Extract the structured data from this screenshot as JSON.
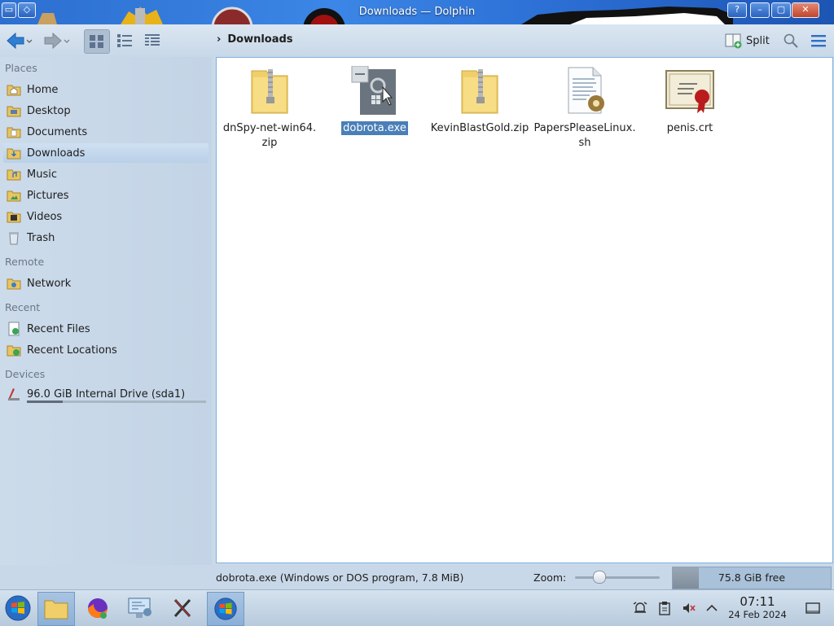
{
  "window": {
    "title": "Downloads — Dolphin"
  },
  "toolbar": {
    "breadcrumb": "Downloads",
    "split_label": "Split"
  },
  "sidebar": {
    "sections": {
      "places": "Places",
      "remote": "Remote",
      "recent": "Recent",
      "devices": "Devices"
    },
    "places": [
      "Home",
      "Desktop",
      "Documents",
      "Downloads",
      "Music",
      "Pictures",
      "Videos",
      "Trash"
    ],
    "remote": [
      "Network"
    ],
    "recent": [
      "Recent Files",
      "Recent Locations"
    ],
    "devices": [
      {
        "label": "96.0 GiB Internal Drive (sda1)",
        "usage_fraction": 0.2
      }
    ],
    "selected": "Downloads"
  },
  "files": [
    {
      "name": "dnSpy-net-win64.zip",
      "line1": "dnSpy-net-win64.",
      "line2": "zip",
      "icon": "zip-folder-icon"
    },
    {
      "name": "dobrota.exe",
      "line1": "dobrota.exe",
      "line2": "",
      "icon": "executable-icon",
      "selected": true
    },
    {
      "name": "KevinBlastGold.zip",
      "line1": "KevinBlastGold.zip",
      "line2": "",
      "icon": "zip-folder-icon"
    },
    {
      "name": "PapersPleaseLinux.sh",
      "line1": "PapersPleaseLinux.",
      "line2": "sh",
      "icon": "script-icon"
    },
    {
      "name": "penis.crt",
      "line1": "penis.crt",
      "line2": "",
      "icon": "certificate-icon"
    }
  ],
  "status": {
    "info": "dobrota.exe (Windows or DOS program, 7.8 MiB)",
    "zoom_label": "Zoom:",
    "zoom_fraction": 0.28,
    "free_space": "75.8 GiB free"
  },
  "taskbar": {
    "time": "07:11",
    "date": "24 Feb 2024"
  },
  "colors": {
    "accent": "#3b86e6",
    "selection": "#4a7fb8"
  }
}
